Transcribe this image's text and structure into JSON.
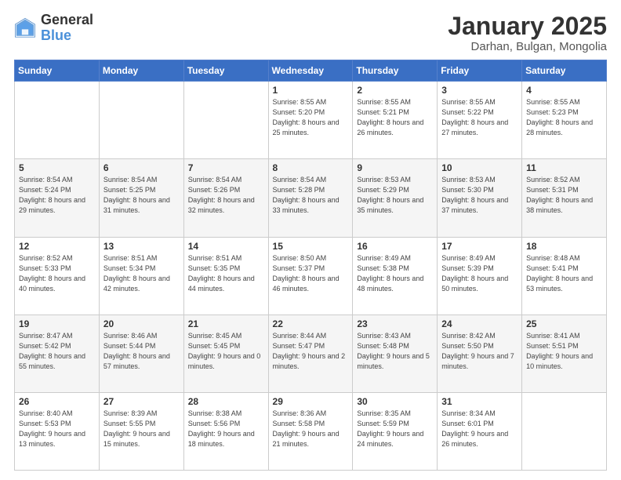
{
  "logo": {
    "general": "General",
    "blue": "Blue"
  },
  "header": {
    "title": "January 2025",
    "subtitle": "Darhan, Bulgan, Mongolia"
  },
  "weekdays": [
    "Sunday",
    "Monday",
    "Tuesday",
    "Wednesday",
    "Thursday",
    "Friday",
    "Saturday"
  ],
  "weeks": [
    [
      null,
      null,
      null,
      {
        "day": 1,
        "sunrise": "8:55 AM",
        "sunset": "5:20 PM",
        "daylight": "8 hours and 25 minutes."
      },
      {
        "day": 2,
        "sunrise": "8:55 AM",
        "sunset": "5:21 PM",
        "daylight": "8 hours and 26 minutes."
      },
      {
        "day": 3,
        "sunrise": "8:55 AM",
        "sunset": "5:22 PM",
        "daylight": "8 hours and 27 minutes."
      },
      {
        "day": 4,
        "sunrise": "8:55 AM",
        "sunset": "5:23 PM",
        "daylight": "8 hours and 28 minutes."
      }
    ],
    [
      {
        "day": 5,
        "sunrise": "8:54 AM",
        "sunset": "5:24 PM",
        "daylight": "8 hours and 29 minutes."
      },
      {
        "day": 6,
        "sunrise": "8:54 AM",
        "sunset": "5:25 PM",
        "daylight": "8 hours and 31 minutes."
      },
      {
        "day": 7,
        "sunrise": "8:54 AM",
        "sunset": "5:26 PM",
        "daylight": "8 hours and 32 minutes."
      },
      {
        "day": 8,
        "sunrise": "8:54 AM",
        "sunset": "5:28 PM",
        "daylight": "8 hours and 33 minutes."
      },
      {
        "day": 9,
        "sunrise": "8:53 AM",
        "sunset": "5:29 PM",
        "daylight": "8 hours and 35 minutes."
      },
      {
        "day": 10,
        "sunrise": "8:53 AM",
        "sunset": "5:30 PM",
        "daylight": "8 hours and 37 minutes."
      },
      {
        "day": 11,
        "sunrise": "8:52 AM",
        "sunset": "5:31 PM",
        "daylight": "8 hours and 38 minutes."
      }
    ],
    [
      {
        "day": 12,
        "sunrise": "8:52 AM",
        "sunset": "5:33 PM",
        "daylight": "8 hours and 40 minutes."
      },
      {
        "day": 13,
        "sunrise": "8:51 AM",
        "sunset": "5:34 PM",
        "daylight": "8 hours and 42 minutes."
      },
      {
        "day": 14,
        "sunrise": "8:51 AM",
        "sunset": "5:35 PM",
        "daylight": "8 hours and 44 minutes."
      },
      {
        "day": 15,
        "sunrise": "8:50 AM",
        "sunset": "5:37 PM",
        "daylight": "8 hours and 46 minutes."
      },
      {
        "day": 16,
        "sunrise": "8:49 AM",
        "sunset": "5:38 PM",
        "daylight": "8 hours and 48 minutes."
      },
      {
        "day": 17,
        "sunrise": "8:49 AM",
        "sunset": "5:39 PM",
        "daylight": "8 hours and 50 minutes."
      },
      {
        "day": 18,
        "sunrise": "8:48 AM",
        "sunset": "5:41 PM",
        "daylight": "8 hours and 53 minutes."
      }
    ],
    [
      {
        "day": 19,
        "sunrise": "8:47 AM",
        "sunset": "5:42 PM",
        "daylight": "8 hours and 55 minutes."
      },
      {
        "day": 20,
        "sunrise": "8:46 AM",
        "sunset": "5:44 PM",
        "daylight": "8 hours and 57 minutes."
      },
      {
        "day": 21,
        "sunrise": "8:45 AM",
        "sunset": "5:45 PM",
        "daylight": "9 hours and 0 minutes."
      },
      {
        "day": 22,
        "sunrise": "8:44 AM",
        "sunset": "5:47 PM",
        "daylight": "9 hours and 2 minutes."
      },
      {
        "day": 23,
        "sunrise": "8:43 AM",
        "sunset": "5:48 PM",
        "daylight": "9 hours and 5 minutes."
      },
      {
        "day": 24,
        "sunrise": "8:42 AM",
        "sunset": "5:50 PM",
        "daylight": "9 hours and 7 minutes."
      },
      {
        "day": 25,
        "sunrise": "8:41 AM",
        "sunset": "5:51 PM",
        "daylight": "9 hours and 10 minutes."
      }
    ],
    [
      {
        "day": 26,
        "sunrise": "8:40 AM",
        "sunset": "5:53 PM",
        "daylight": "9 hours and 13 minutes."
      },
      {
        "day": 27,
        "sunrise": "8:39 AM",
        "sunset": "5:55 PM",
        "daylight": "9 hours and 15 minutes."
      },
      {
        "day": 28,
        "sunrise": "8:38 AM",
        "sunset": "5:56 PM",
        "daylight": "9 hours and 18 minutes."
      },
      {
        "day": 29,
        "sunrise": "8:36 AM",
        "sunset": "5:58 PM",
        "daylight": "9 hours and 21 minutes."
      },
      {
        "day": 30,
        "sunrise": "8:35 AM",
        "sunset": "5:59 PM",
        "daylight": "9 hours and 24 minutes."
      },
      {
        "day": 31,
        "sunrise": "8:34 AM",
        "sunset": "6:01 PM",
        "daylight": "9 hours and 26 minutes."
      },
      null
    ]
  ]
}
